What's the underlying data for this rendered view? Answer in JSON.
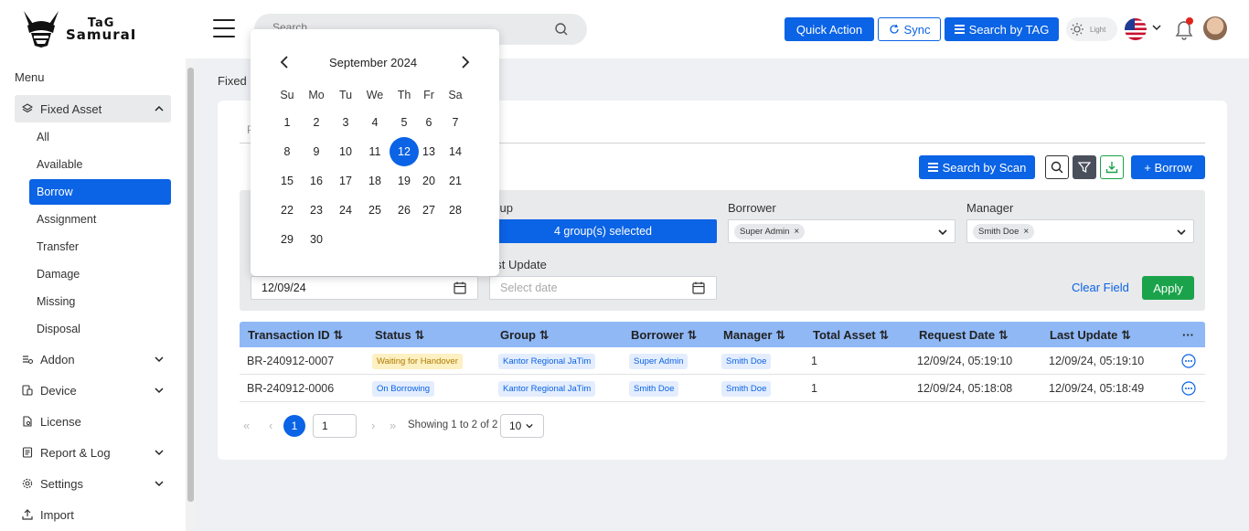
{
  "brand": {
    "line1": "TaG",
    "line2": "SamuraI"
  },
  "header": {
    "search_placeholder": "Search",
    "quick_action": "Quick Action",
    "sync": "Sync",
    "search_by_tag": "Search by TAG",
    "theme": "Light"
  },
  "sidebar": {
    "menu_title": "Menu",
    "fixed_asset": "Fixed Asset",
    "sub": [
      "All",
      "Available",
      "Borrow",
      "Assignment",
      "Transfer",
      "Damage",
      "Missing",
      "Disposal"
    ],
    "items": [
      "Addon",
      "Device",
      "License",
      "Report & Log",
      "Settings",
      "Import"
    ]
  },
  "main": {
    "breadcrumb": "Fixed",
    "search_by_scan": "Search by Scan",
    "borrow_button": "+ Borrow"
  },
  "filters": {
    "group_label": "roup",
    "group_value": "4 group(s) selected",
    "borrower_label": "Borrower",
    "borrower_chip": "Super Admin",
    "manager_label": "Manager",
    "manager_chip": "Smith Doe",
    "last_update_label": "ast Update",
    "date_value": "12/09/24",
    "last_update_placeholder": "Select date",
    "clear": "Clear Field",
    "apply": "Apply"
  },
  "table": {
    "headers": [
      "Transaction ID ⇅",
      "Status ⇅",
      "Group ⇅",
      "Borrower ⇅",
      "Manager ⇅",
      "Total Asset ⇅",
      "Request Date ⇅",
      "Last Update ⇅"
    ],
    "more": "···",
    "rows": [
      {
        "id": "BR-240912-0007",
        "status": "Waiting for Handover",
        "group": "Kantor Regional JaTim",
        "borrower": "Super Admin",
        "manager": "Smith Doe",
        "total": "1",
        "request": "12/09/24, 05:19:10",
        "last": "12/09/24, 05:19:10"
      },
      {
        "id": "BR-240912-0006",
        "status": "On Borrowing",
        "group": "Kantor Regional JaTim",
        "borrower": "Smith Doe",
        "manager": "Smith Doe",
        "total": "1",
        "request": "12/09/24, 05:18:08",
        "last": "12/09/24, 05:18:49"
      }
    ]
  },
  "pagination": {
    "current": "1",
    "input": "1",
    "info": "Showing 1 to 2 of 2",
    "page_size": "10"
  },
  "calendar": {
    "title": "September 2024",
    "dow": [
      "Su",
      "Mo",
      "Tu",
      "We",
      "Th",
      "Fr",
      "Sa"
    ],
    "weeks": [
      [
        "1",
        "2",
        "3",
        "4",
        "5",
        "6",
        "7"
      ],
      [
        "8",
        "9",
        "10",
        "11",
        "12",
        "13",
        "14"
      ],
      [
        "15",
        "16",
        "17",
        "18",
        "19",
        "20",
        "21"
      ],
      [
        "22",
        "23",
        "24",
        "25",
        "26",
        "27",
        "28"
      ],
      [
        "29",
        "30"
      ]
    ],
    "selected": "12"
  },
  "colors": {
    "primary": "#0b63e5",
    "apply": "#1aa34a",
    "table_header": "#8fb8f5"
  }
}
